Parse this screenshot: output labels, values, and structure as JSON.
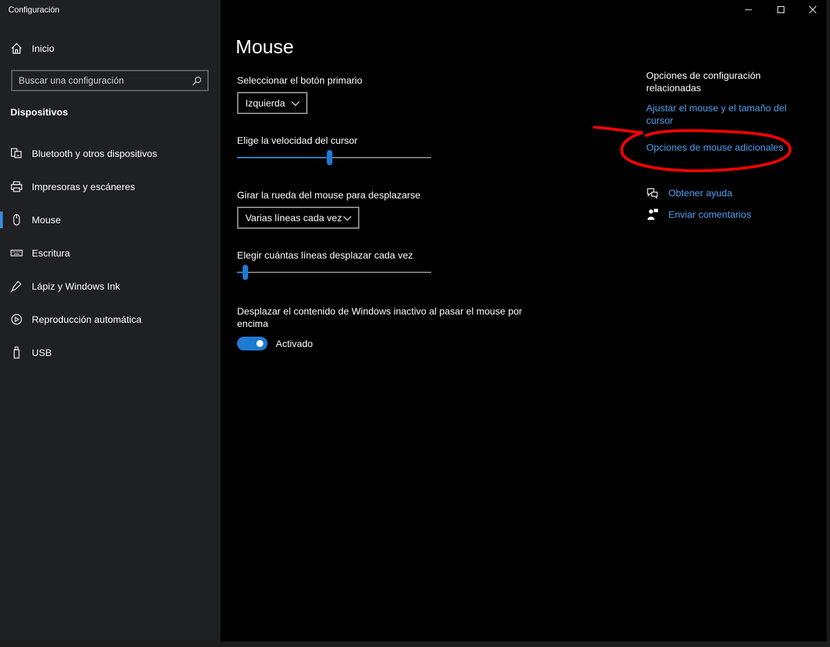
{
  "window": {
    "title": "Configuración",
    "controls": {
      "minimize": "minimize-icon",
      "maximize": "maximize-icon",
      "close": "close-icon"
    }
  },
  "sidebar": {
    "home_label": "Inicio",
    "search_placeholder": "Buscar una configuración",
    "section_title": "Dispositivos",
    "items": [
      {
        "label": "Bluetooth y otros dispositivos",
        "icon": "bluetooth-devices-icon",
        "active": false
      },
      {
        "label": "Impresoras y escáneres",
        "icon": "printer-icon",
        "active": false
      },
      {
        "label": "Mouse",
        "icon": "mouse-icon",
        "active": true
      },
      {
        "label": "Escritura",
        "icon": "keyboard-icon",
        "active": false
      },
      {
        "label": "Lápiz y Windows Ink",
        "icon": "pen-icon",
        "active": false
      },
      {
        "label": "Reproducción automática",
        "icon": "autoplay-icon",
        "active": false
      },
      {
        "label": "USB",
        "icon": "usb-icon",
        "active": false
      }
    ]
  },
  "main": {
    "title": "Mouse",
    "primary_button": {
      "label": "Seleccionar el botón primario",
      "value": "Izquierda"
    },
    "cursor_speed": {
      "label": "Elige la velocidad del cursor",
      "value_fraction": 0.475
    },
    "wheel": {
      "label": "Girar la rueda del mouse para desplazarse",
      "value": "Varias líneas cada vez"
    },
    "lines": {
      "label": "Elegir cuántas líneas desplazar cada vez",
      "value_fraction": 0.03
    },
    "inactive_scroll": {
      "label": "Desplazar el contenido de Windows inactivo al pasar el mouse por encima",
      "state_label": "Activado",
      "on": true
    }
  },
  "related": {
    "title": "Opciones de configuración relacionadas",
    "links": [
      "Ajustar el mouse y el tamaño del cursor",
      "Opciones de mouse adicionales"
    ],
    "help": "Obtener ayuda",
    "feedback": "Enviar comentarios"
  },
  "colors": {
    "sidebar_bg": "#1f2023",
    "main_bg": "#000000",
    "accent": "#1f7ad4",
    "link": "#4aa0ee",
    "annotation": "#ff0000"
  }
}
